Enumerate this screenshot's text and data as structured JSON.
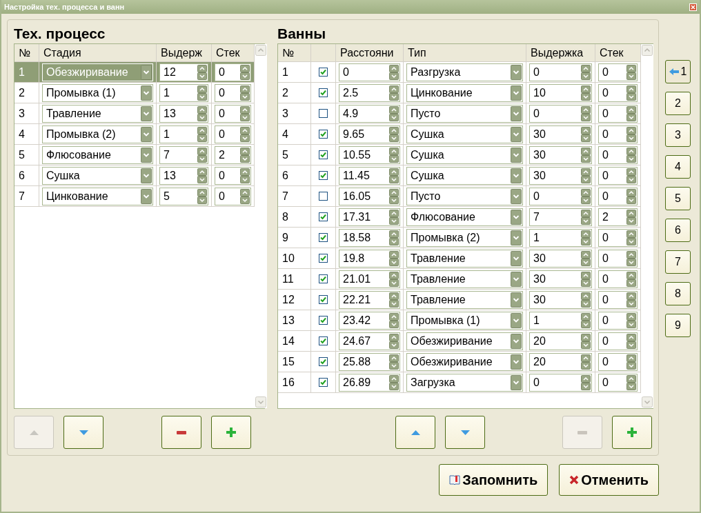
{
  "window": {
    "title": "Настройка тех. процесса и ванн"
  },
  "process": {
    "title": "Тех. процесс",
    "columns": [
      "№",
      "Стадия",
      "Выдерж",
      "Стек"
    ],
    "rows": [
      {
        "num": "1",
        "stage": "Обезжиривание",
        "hold": "12",
        "stack": "0",
        "selected": true
      },
      {
        "num": "2",
        "stage": "Промывка (1)",
        "hold": "1",
        "stack": "0",
        "selected": false
      },
      {
        "num": "3",
        "stage": "Травление",
        "hold": "13",
        "stack": "0",
        "selected": false
      },
      {
        "num": "4",
        "stage": "Промывка (2)",
        "hold": "1",
        "stack": "0",
        "selected": false
      },
      {
        "num": "5",
        "stage": "Флюсование",
        "hold": "7",
        "stack": "2",
        "selected": false
      },
      {
        "num": "6",
        "stage": "Сушка",
        "hold": "13",
        "stack": "0",
        "selected": false
      },
      {
        "num": "7",
        "stage": "Цинкование",
        "hold": "5",
        "stack": "0",
        "selected": false
      }
    ],
    "buttons": [
      {
        "kind": "up",
        "disabled": true
      },
      {
        "kind": "down",
        "disabled": false
      },
      {
        "kind": "minus",
        "disabled": false
      },
      {
        "kind": "plus",
        "disabled": false
      }
    ]
  },
  "baths": {
    "title": "Ванны",
    "columns": [
      "№",
      "Расстояни",
      "Тип",
      "Выдержка",
      "Стек"
    ],
    "rows": [
      {
        "num": "1",
        "enabled": true,
        "distance": "0",
        "type": "Разгрузка",
        "hold": "0",
        "stack": "0"
      },
      {
        "num": "2",
        "enabled": true,
        "distance": "2.5",
        "type": "Цинкование",
        "hold": "10",
        "stack": "0"
      },
      {
        "num": "3",
        "enabled": false,
        "distance": "4.9",
        "type": "Пусто",
        "hold": "0",
        "stack": "0"
      },
      {
        "num": "4",
        "enabled": true,
        "distance": "9.65",
        "type": "Сушка",
        "hold": "30",
        "stack": "0"
      },
      {
        "num": "5",
        "enabled": true,
        "distance": "10.55",
        "type": "Сушка",
        "hold": "30",
        "stack": "0"
      },
      {
        "num": "6",
        "enabled": true,
        "distance": "11.45",
        "type": "Сушка",
        "hold": "30",
        "stack": "0"
      },
      {
        "num": "7",
        "enabled": false,
        "distance": "16.05",
        "type": "Пусто",
        "hold": "0",
        "stack": "0"
      },
      {
        "num": "8",
        "enabled": true,
        "distance": "17.31",
        "type": "Флюсование",
        "hold": "7",
        "stack": "2"
      },
      {
        "num": "9",
        "enabled": true,
        "distance": "18.58",
        "type": "Промывка (2)",
        "hold": "1",
        "stack": "0"
      },
      {
        "num": "10",
        "enabled": true,
        "distance": "19.8",
        "type": "Травление",
        "hold": "30",
        "stack": "0"
      },
      {
        "num": "11",
        "enabled": true,
        "distance": "21.01",
        "type": "Травление",
        "hold": "30",
        "stack": "0"
      },
      {
        "num": "12",
        "enabled": true,
        "distance": "22.21",
        "type": "Травление",
        "hold": "30",
        "stack": "0"
      },
      {
        "num": "13",
        "enabled": true,
        "distance": "23.42",
        "type": "Промывка (1)",
        "hold": "1",
        "stack": "0"
      },
      {
        "num": "14",
        "enabled": true,
        "distance": "24.67",
        "type": "Обезжиривание",
        "hold": "20",
        "stack": "0"
      },
      {
        "num": "15",
        "enabled": true,
        "distance": "25.88",
        "type": "Обезжиривание",
        "hold": "20",
        "stack": "0"
      },
      {
        "num": "16",
        "enabled": true,
        "distance": "26.89",
        "type": "Загрузка",
        "hold": "0",
        "stack": "0"
      }
    ],
    "buttons": [
      {
        "kind": "up",
        "disabled": false
      },
      {
        "kind": "down",
        "disabled": false
      },
      {
        "kind": "minus",
        "disabled": true
      },
      {
        "kind": "plus",
        "disabled": false
      }
    ]
  },
  "lines": [
    {
      "label": "1",
      "selected": true
    },
    {
      "label": "2",
      "selected": false
    },
    {
      "label": "3",
      "selected": false
    },
    {
      "label": "4",
      "selected": false
    },
    {
      "label": "5",
      "selected": false
    },
    {
      "label": "6",
      "selected": false
    },
    {
      "label": "7",
      "selected": false
    },
    {
      "label": "8",
      "selected": false
    },
    {
      "label": "9",
      "selected": false
    }
  ],
  "footer": [
    {
      "kind": "save",
      "label": "Запомнить"
    },
    {
      "kind": "cancel",
      "label": "Отменить"
    }
  ]
}
